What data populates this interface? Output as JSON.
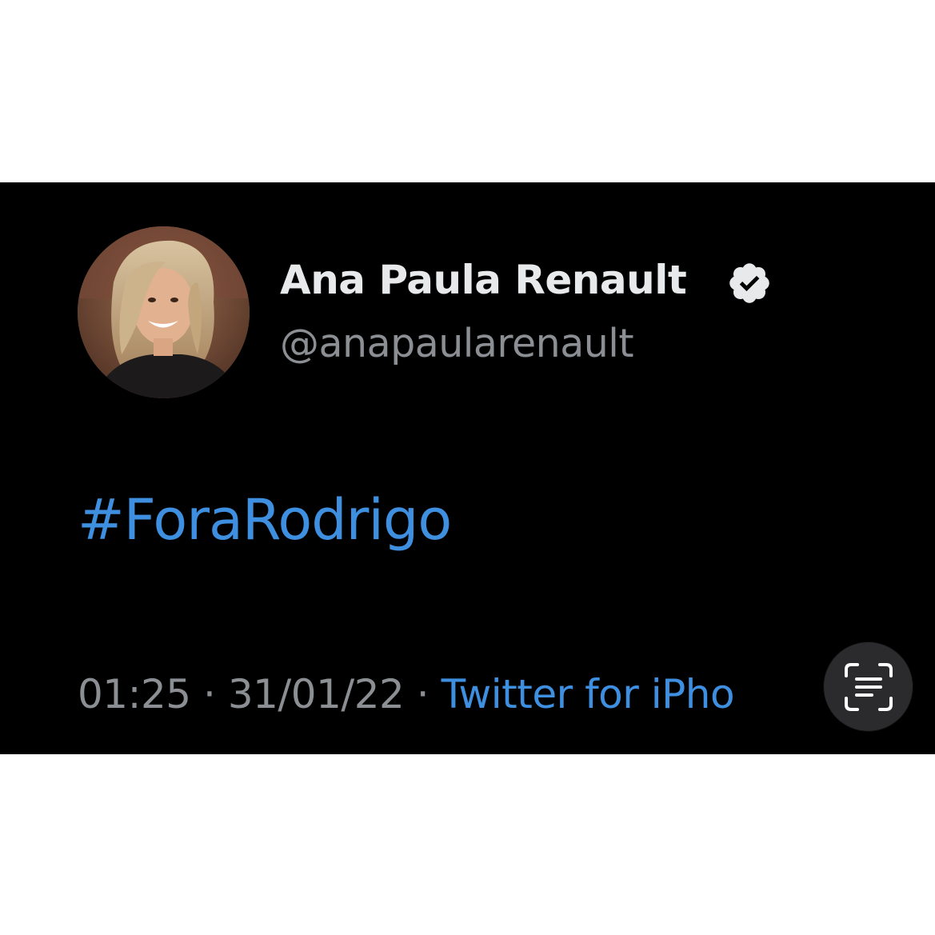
{
  "tweet": {
    "display_name": "Ana Paula Renault",
    "handle": "@anapaularenault",
    "text": "#ForaRodrigo",
    "time": "01:25",
    "separator": "·",
    "date": "31/01/22",
    "source": "Twitter for iPhone",
    "source_visible": "Twitter for iPho",
    "verified_icon": "verified-badge-icon",
    "avatar_icon": "profile-photo"
  },
  "overlay": {
    "live_text_icon": "live-text-scan-icon"
  },
  "colors": {
    "background": "#000000",
    "name": "#e7e9ea",
    "secondary": "#8b8f93",
    "link": "#3f8fe0",
    "overlay_button": "#2b2b2d"
  }
}
